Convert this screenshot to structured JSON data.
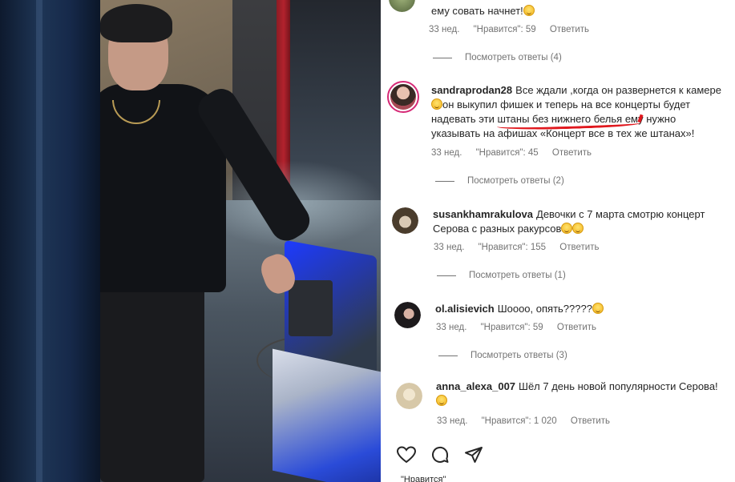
{
  "comments": [
    {
      "user": "",
      "text": "ему совать начнет!",
      "age": "33 нед.",
      "likes": "\"Нравится\": 59",
      "reply": "Ответить",
      "view_replies": "Посмотреть ответы (4)"
    },
    {
      "user": "sandraprodan28",
      "text": "Все ждали ,когда он развернется к камере 😂он выкупил фишек и теперь на все концерты будет надевать эти штаны без нижнего белья😂 ему нужно указывать на афишах «Концерт все в тех же штанах»!",
      "line1": "Все ждали ,когда он развернется к камере",
      "line2": "он выкупил фишек и теперь на все концерты будет",
      "line3": "надевать эти штаны без нижнего белья",
      "line3b": "ему нужно",
      "line4": "указывать на афишах «Концерт все в тех же штанах»!",
      "age": "33 нед.",
      "likes": "\"Нравится\": 45",
      "reply": "Ответить",
      "view_replies": "Посмотреть ответы (2)"
    },
    {
      "user": "susankhamrakulova",
      "line1": "Девочки с 7 марта смотрю концерт",
      "line2": "Серова с разных ракурсов",
      "age": "33 нед.",
      "likes": "\"Нравится\": 155",
      "reply": "Ответить",
      "view_replies": "Посмотреть ответы (1)"
    },
    {
      "user": "ol.alisievich",
      "line1": "Шоооо, опять?????",
      "age": "33 нед.",
      "likes": "\"Нравится\": 59",
      "reply": "Ответить",
      "view_replies": "Посмотреть ответы (3)"
    },
    {
      "user": "anna_alexa_007",
      "line1": "Шёл 7 день новой популярности Серова!",
      "age": "33 нед.",
      "likes": "\"Нравится\": 1 020",
      "reply": "Ответить"
    }
  ],
  "actions": {
    "like": "heart-icon",
    "comment": "comment-icon",
    "share": "share-icon"
  },
  "footer_cutoff": "\"Нравится\"",
  "colors": {
    "underline": "#e0181e",
    "meta": "#737373",
    "text": "#262626"
  }
}
